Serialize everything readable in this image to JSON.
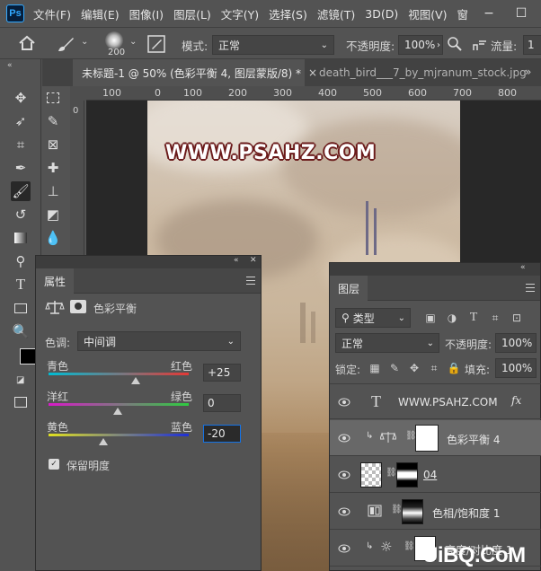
{
  "app": {
    "logo": "Ps"
  },
  "menu": [
    "文件(F)",
    "编辑(E)",
    "图像(I)",
    "图层(L)",
    "文字(Y)",
    "选择(S)",
    "滤镜(T)",
    "3D(D)",
    "视图(V)",
    "窗"
  ],
  "window_controls": {
    "minimize": "−",
    "maximize": "☐"
  },
  "options": {
    "brush_size": "200",
    "mode_label": "模式:",
    "mode_value": "正常",
    "opacity_label": "不透明度:",
    "opacity_value": "100%",
    "flow_label": "流量:",
    "flow_value": "1"
  },
  "tabs": [
    {
      "label": "未标题-1 @ 50% (色彩平衡 4, 图层蒙版/8) *",
      "close": "×"
    },
    {
      "label": "death_bird___7_by_mjranum_stock.jpg",
      "close": ""
    }
  ],
  "tabs_overflow": "»",
  "ruler": {
    "ticks": [
      "100",
      "0",
      "100",
      "200",
      "300",
      "400",
      "500",
      "600",
      "700",
      "800"
    ],
    "vertical_ticks": [
      "0"
    ]
  },
  "canvas": {
    "watermark": "WWW.PSAHZ.COM"
  },
  "properties": {
    "tab": "属性",
    "adjustment_title": "色彩平衡",
    "tone_label": "色调:",
    "tone_value": "中间调",
    "sliders": [
      {
        "left": "青色",
        "right": "红色",
        "value": "+25",
        "position": 0.625,
        "colors": [
          "#00bcd4",
          "#e53935"
        ]
      },
      {
        "left": "洋红",
        "right": "绿色",
        "value": "0",
        "position": 0.5,
        "colors": [
          "#d81bc8",
          "#2ecc40"
        ]
      },
      {
        "left": "黄色",
        "right": "蓝色",
        "value": "-20",
        "position": 0.4,
        "colors": [
          "#e0e020",
          "#1e2fd8"
        ]
      }
    ],
    "preserve_label": "保留明度",
    "preserve_checked": true
  },
  "layers_panel": {
    "tab": "图层",
    "filter_label": "类型",
    "blend_mode": "正常",
    "opacity_label": "不透明度:",
    "opacity_value": "100%",
    "lock_label": "锁定:",
    "fill_label": "填充:",
    "fill_value": "100%",
    "layers": [
      {
        "name": "WWW.PSAHZ.COM",
        "kind": "text",
        "fx": "fx"
      },
      {
        "name": "色彩平衡 4",
        "kind": "balance"
      },
      {
        "name": "04",
        "kind": "image"
      },
      {
        "name": "色相/饱和度 1",
        "kind": "hue"
      },
      {
        "name": "亮度/对比度 1",
        "kind": "brightness"
      }
    ]
  },
  "site_logo": "UiBQ.CoM"
}
